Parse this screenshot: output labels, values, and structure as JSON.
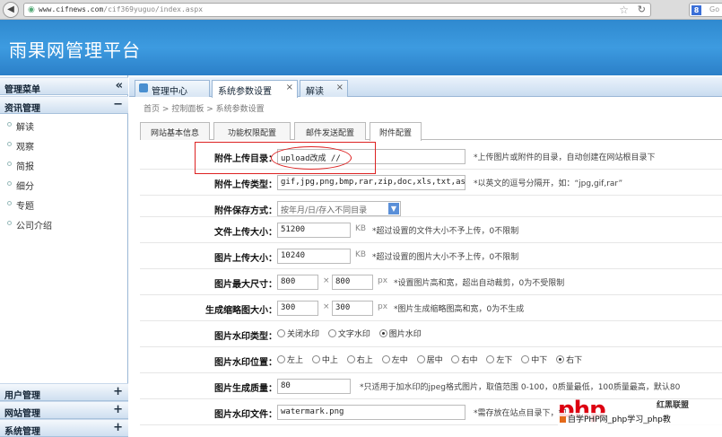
{
  "browser": {
    "url_domain": "www.cifnews.com",
    "url_path": "/cif369yuguo/index.aspx",
    "search_text": "Go",
    "search_engine_letter": "8"
  },
  "app": {
    "title": "雨果网管理平台"
  },
  "sidebar": {
    "header": {
      "label": "管理菜单",
      "toggle": "«"
    },
    "sections": [
      {
        "label": "资讯管理",
        "toggle": "−",
        "items": [
          "解读",
          "观察",
          "简报",
          "细分",
          "专题",
          "公司介绍"
        ]
      },
      {
        "label": "用户管理",
        "toggle": "+"
      },
      {
        "label": "网站管理",
        "toggle": "+"
      },
      {
        "label": "系统管理",
        "toggle": "+"
      }
    ]
  },
  "tabs": [
    {
      "label": "管理中心",
      "closable": false
    },
    {
      "label": "系统参数设置",
      "closable": true,
      "close": "×"
    },
    {
      "label": "解读",
      "closable": true,
      "close": "×"
    }
  ],
  "breadcrumb": {
    "items": [
      "首页",
      "控制面板",
      "系统参数设置"
    ],
    "separator": ">"
  },
  "subtabs": [
    "网站基本信息",
    "功能权限配置",
    "邮件发送配置",
    "附件配置"
  ],
  "active_subtab": 3,
  "form": {
    "upload_dir": {
      "label": "附件上传目录：",
      "value": "upload改成 //",
      "hint": "*上传图片或附件的目录，自动创建在网站根目录下"
    },
    "upload_types": {
      "label": "附件上传类型：",
      "value": "gif,jpg,png,bmp,rar,zip,doc,xls,txt,aspx,a:",
      "hint": "*以英文的逗号分隔开，如：“jpg,gif,rar”"
    },
    "save_mode": {
      "label": "附件保存方式：",
      "value": "按年月/日/存入不同目录"
    },
    "file_max": {
      "label": "文件上传大小：",
      "value": "51200",
      "unit": "KB",
      "hint": "*超过设置的文件大小不予上传，0不限制"
    },
    "image_max": {
      "label": "图片上传大小：",
      "value": "10240",
      "unit": "KB",
      "hint": "*超过设置的图片大小不予上传，0不限制"
    },
    "image_size": {
      "label": "图片最大尺寸：",
      "width": "800",
      "height": "800",
      "times": "×",
      "unit": "px",
      "hint": "*设置图片高和宽，超出自动裁剪，0为不受限制"
    },
    "thumb_size": {
      "label": "生成缩略图大小：",
      "width": "300",
      "height": "300",
      "times": "×",
      "unit": "px",
      "hint": "*图片生成缩略图高和宽，0为不生成"
    },
    "watermark_type": {
      "label": "图片水印类型：",
      "options": [
        "关闭水印",
        "文字水印",
        "图片水印"
      ],
      "selected": 2
    },
    "watermark_pos": {
      "label": "图片水印位置：",
      "options": [
        "左上",
        "中上",
        "右上",
        "左中",
        "居中",
        "右中",
        "左下",
        "中下",
        "右下"
      ],
      "selected": 8
    },
    "quality": {
      "label": "图片生成质量：",
      "value": "80",
      "hint": "*只适用于加水印的jpeg格式图片，取值范围 0-100，0质量最低，100质量最高，默认80"
    },
    "watermark_file": {
      "label": "图片水印文件：",
      "value": "watermark.png",
      "hint": "*需存放在站点目录下，如"
    }
  },
  "watermark": {
    "logo": "php",
    "side": "红黑联盟",
    "text": "自学PHP网_php学习_php教"
  }
}
